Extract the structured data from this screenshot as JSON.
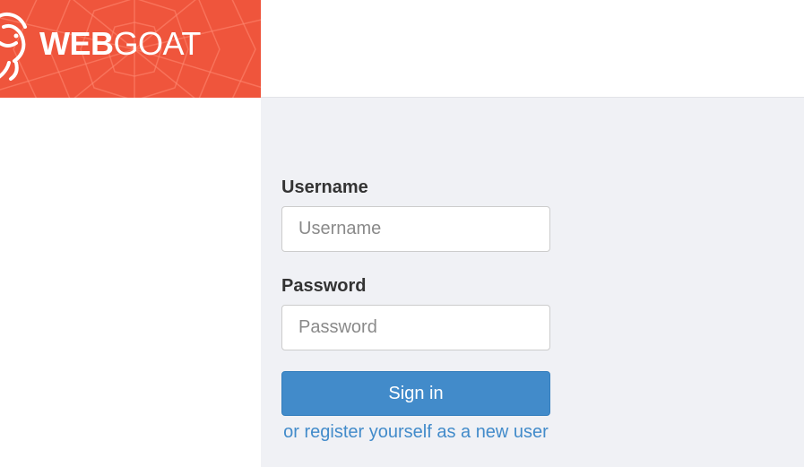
{
  "header": {
    "brand_bold": "WEB",
    "brand_light": "GOAT",
    "logo_icon": "goat-icon",
    "brand_color": "#ef553c"
  },
  "login": {
    "username_label": "Username",
    "username_placeholder": "Username",
    "username_value": "",
    "password_label": "Password",
    "password_placeholder": "Password",
    "password_value": "",
    "signin_label": "Sign in",
    "register_link": "or register yourself as a new user",
    "button_color": "#428bca",
    "link_color": "#428bca"
  }
}
